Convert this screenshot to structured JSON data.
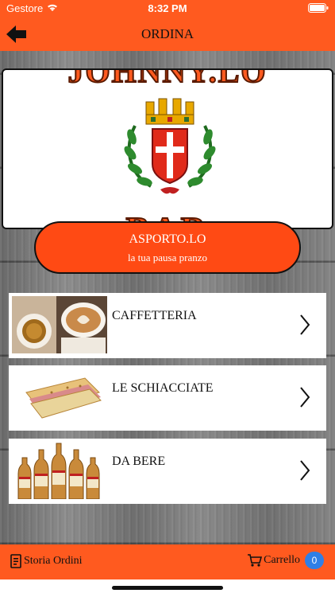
{
  "status_bar": {
    "carrier": "Gestore",
    "time": "8:32 PM"
  },
  "nav": {
    "title": "ORDINA"
  },
  "logo": {
    "top_text": "JOHNNY.LO",
    "bottom_text": "BAR"
  },
  "promo": {
    "title": "ASPORTO.LO",
    "subtitle": "la tua pausa pranzo"
  },
  "categories": [
    {
      "label": "CAFFETTERIA"
    },
    {
      "label": "LE SCHIACCIATE"
    },
    {
      "label": "DA BERE"
    }
  ],
  "tab_bar": {
    "history_label": "Storia Ordini",
    "cart_label": "Carrello",
    "cart_count": "0"
  },
  "colors": {
    "accent": "#ff5a1f",
    "badge": "#2f7fe6"
  }
}
